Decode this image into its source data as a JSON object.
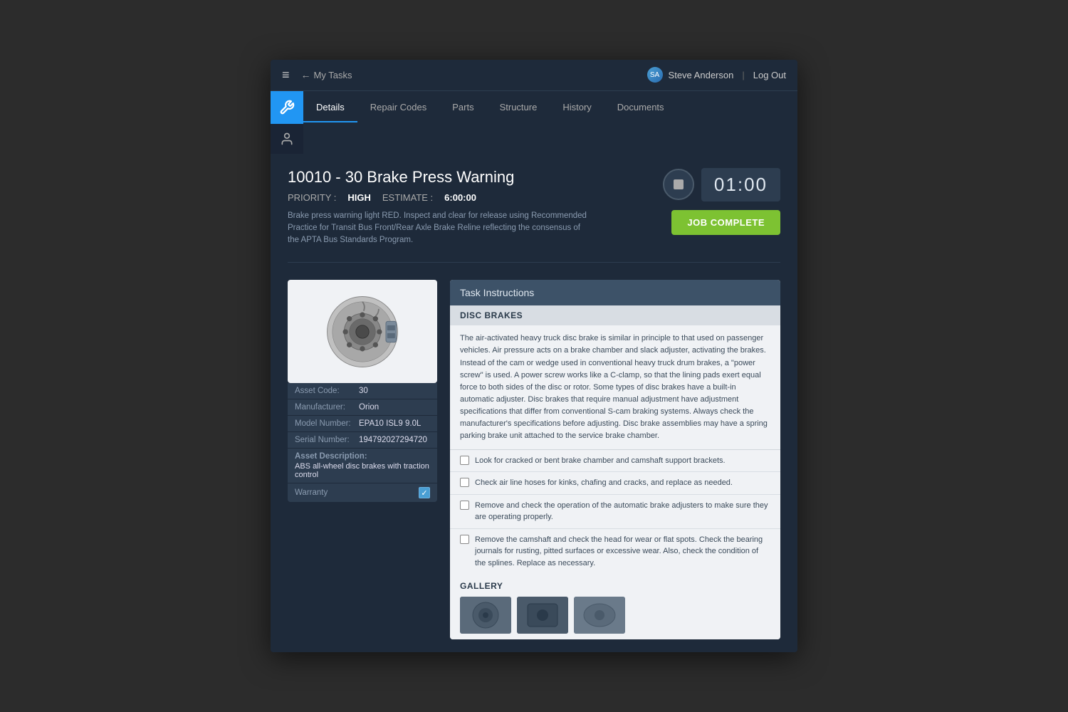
{
  "topbar": {
    "menu_icon": "≡",
    "back_arrow": "←",
    "back_label": "My Tasks",
    "user_name": "Steve Anderson",
    "separator": "|",
    "logout_label": "Log Out"
  },
  "tabs": [
    {
      "id": "details",
      "label": "Details",
      "active": true
    },
    {
      "id": "repair_codes",
      "label": "Repair Codes",
      "active": false
    },
    {
      "id": "parts",
      "label": "Parts",
      "active": false
    },
    {
      "id": "structure",
      "label": "Structure",
      "active": false
    },
    {
      "id": "history",
      "label": "History",
      "active": false
    },
    {
      "id": "documents",
      "label": "Documents",
      "active": false
    }
  ],
  "job": {
    "title": "10010 - 30 Brake Press Warning",
    "priority_label": "PRIORITY :",
    "priority_value": "HIGH",
    "estimate_label": "ESTIMATE :",
    "estimate_value": "6:00:00",
    "description": "Brake press warning light RED. Inspect and clear for release using Recommended Practice for Transit Bus Front/Rear Axle Brake Reline reflecting  the consensus of the APTA Bus Standards Program.",
    "timer_value": "01:00",
    "job_complete_label": "JOB COMPLETE"
  },
  "asset": {
    "code_label": "Asset Code:",
    "code_value": "30",
    "manufacturer_label": "Manufacturer:",
    "manufacturer_value": "Orion",
    "model_label": "Model Number:",
    "model_value": "EPA10 ISL9 9.0L",
    "serial_label": "Serial Number:",
    "serial_value": "194792027294720",
    "desc_label": "Asset Description:",
    "desc_value": "ABS all-wheel disc brakes with traction control",
    "warranty_label": "Warranty",
    "warranty_checked": true
  },
  "task_instructions": {
    "header": "Task Instructions",
    "section_header": "DISC BRAKES",
    "description": "The air-activated heavy truck disc brake is similar in principle to that used on passenger vehicles. Air pressure acts on a brake chamber and slack adjuster, activating the brakes. Instead of the cam or wedge used in conventional heavy truck drum brakes, a \"power screw\" is used. A power screw works like a C-clamp, so that the lining pads exert equal force to both sides of the disc or rotor. Some types of disc brakes have a built-in automatic adjuster. Disc brakes that require manual adjustment have adjustment specifications that differ from conventional S-cam braking systems. Always check the manufacturer's specifications before adjusting. Disc brake assemblies may have a spring parking brake unit attached to the service brake chamber.",
    "checklist": [
      "Look for cracked or bent brake chamber and camshaft support brackets.",
      "Check air line hoses for kinks, chafing and cracks, and replace as needed.",
      "Remove and check the operation of the automatic brake adjusters to make sure they are operating properly.",
      "Remove the camshaft and check the head for wear or flat spots. Check the bearing journals for rusting, pitted surfaces or excessive wear. Also, check the condition of the splines. Replace as necessary."
    ],
    "gallery_header": "GALLERY"
  },
  "icons": {
    "wrench": "🔧",
    "person": "👤",
    "checkmark": "✓"
  }
}
